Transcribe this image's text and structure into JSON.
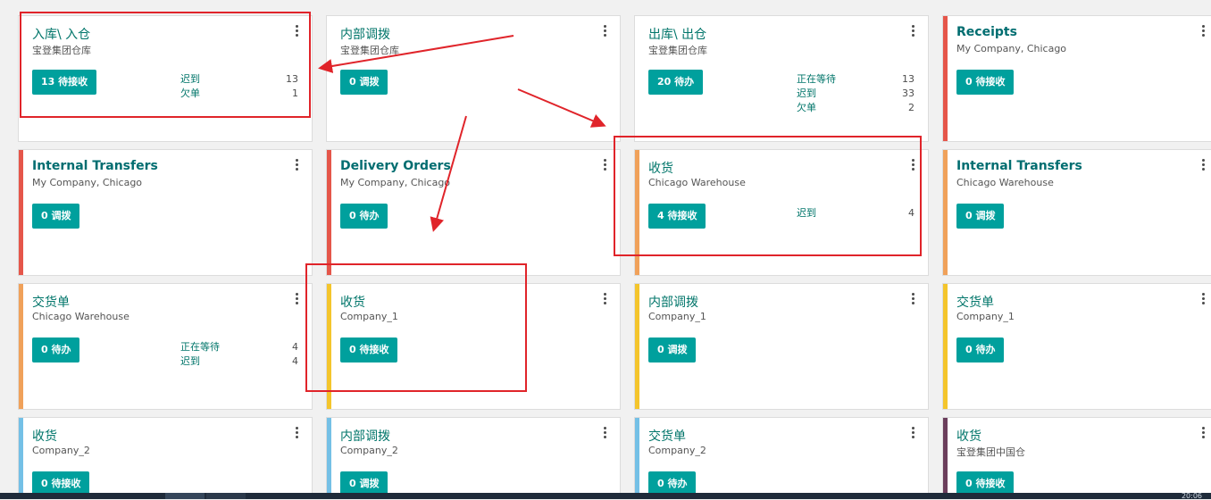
{
  "colors": {
    "accent": "#00a09d",
    "title": "#00756a",
    "highlight": "#e0242a",
    "bar_red": "#e5564a",
    "bar_orange": "#f0a15a",
    "bar_yellow": "#f4c52c",
    "bar_blue": "#74c0e6",
    "bar_purple": "#6b3e5c"
  },
  "cards": [
    {
      "title": "入库\\ 入仓",
      "subtitle": "宝登集团仓库",
      "button": "13 待接收",
      "bar": "none",
      "stats": [
        {
          "label": "迟到",
          "value": "13"
        },
        {
          "label": "欠单",
          "value": "1"
        }
      ]
    },
    {
      "title": "内部调拨",
      "subtitle": "宝登集团仓库",
      "button": "0 调拨",
      "bar": "none",
      "stats": []
    },
    {
      "title": "出库\\ 出仓",
      "subtitle": "宝登集团仓库",
      "button": "20 待办",
      "bar": "none",
      "stats": [
        {
          "label": "正在等待",
          "value": "13"
        },
        {
          "label": "迟到",
          "value": "33"
        },
        {
          "label": "欠单",
          "value": "2"
        }
      ]
    },
    {
      "title": "Receipts",
      "subtitle": "My Company, Chicago",
      "button": "0 待接收",
      "bar": "red",
      "stats": []
    },
    {
      "title": "Internal Transfers",
      "subtitle": "My Company, Chicago",
      "button": "0 调拨",
      "bar": "red",
      "stats": []
    },
    {
      "title": "Delivery Orders",
      "subtitle": "My Company, Chicago",
      "button": "0 待办",
      "bar": "red",
      "stats": []
    },
    {
      "title": "收货",
      "subtitle": "Chicago Warehouse",
      "button": "4 待接收",
      "bar": "orange",
      "stats": [
        {
          "label": "迟到",
          "value": "4"
        }
      ]
    },
    {
      "title": "Internal Transfers",
      "subtitle": "Chicago Warehouse",
      "button": "0 调拨",
      "bar": "orange",
      "stats": []
    },
    {
      "title": "交货单",
      "subtitle": "Chicago Warehouse",
      "button": "0 待办",
      "bar": "orange",
      "stats": [
        {
          "label": "正在等待",
          "value": "4"
        },
        {
          "label": "迟到",
          "value": "4"
        }
      ]
    },
    {
      "title": "收货",
      "subtitle": "Company_1",
      "button": "0 待接收",
      "bar": "yellow",
      "stats": []
    },
    {
      "title": "内部调拨",
      "subtitle": "Company_1",
      "button": "0 调拨",
      "bar": "yellow",
      "stats": []
    },
    {
      "title": "交货单",
      "subtitle": "Company_1",
      "button": "0 待办",
      "bar": "yellow",
      "stats": []
    },
    {
      "title": "收货",
      "subtitle": "Company_2",
      "button": "0 待接收",
      "bar": "blue",
      "stats": []
    },
    {
      "title": "内部调拨",
      "subtitle": "Company_2",
      "button": "0 调拨",
      "bar": "blue",
      "stats": []
    },
    {
      "title": "交货单",
      "subtitle": "Company_2",
      "button": "0 待办",
      "bar": "blue",
      "stats": []
    },
    {
      "title": "收货",
      "subtitle": "宝登集团中国仓",
      "button": "0 待接收",
      "bar": "purple",
      "stats": []
    }
  ],
  "taskbar": {
    "clock": "20:06"
  }
}
